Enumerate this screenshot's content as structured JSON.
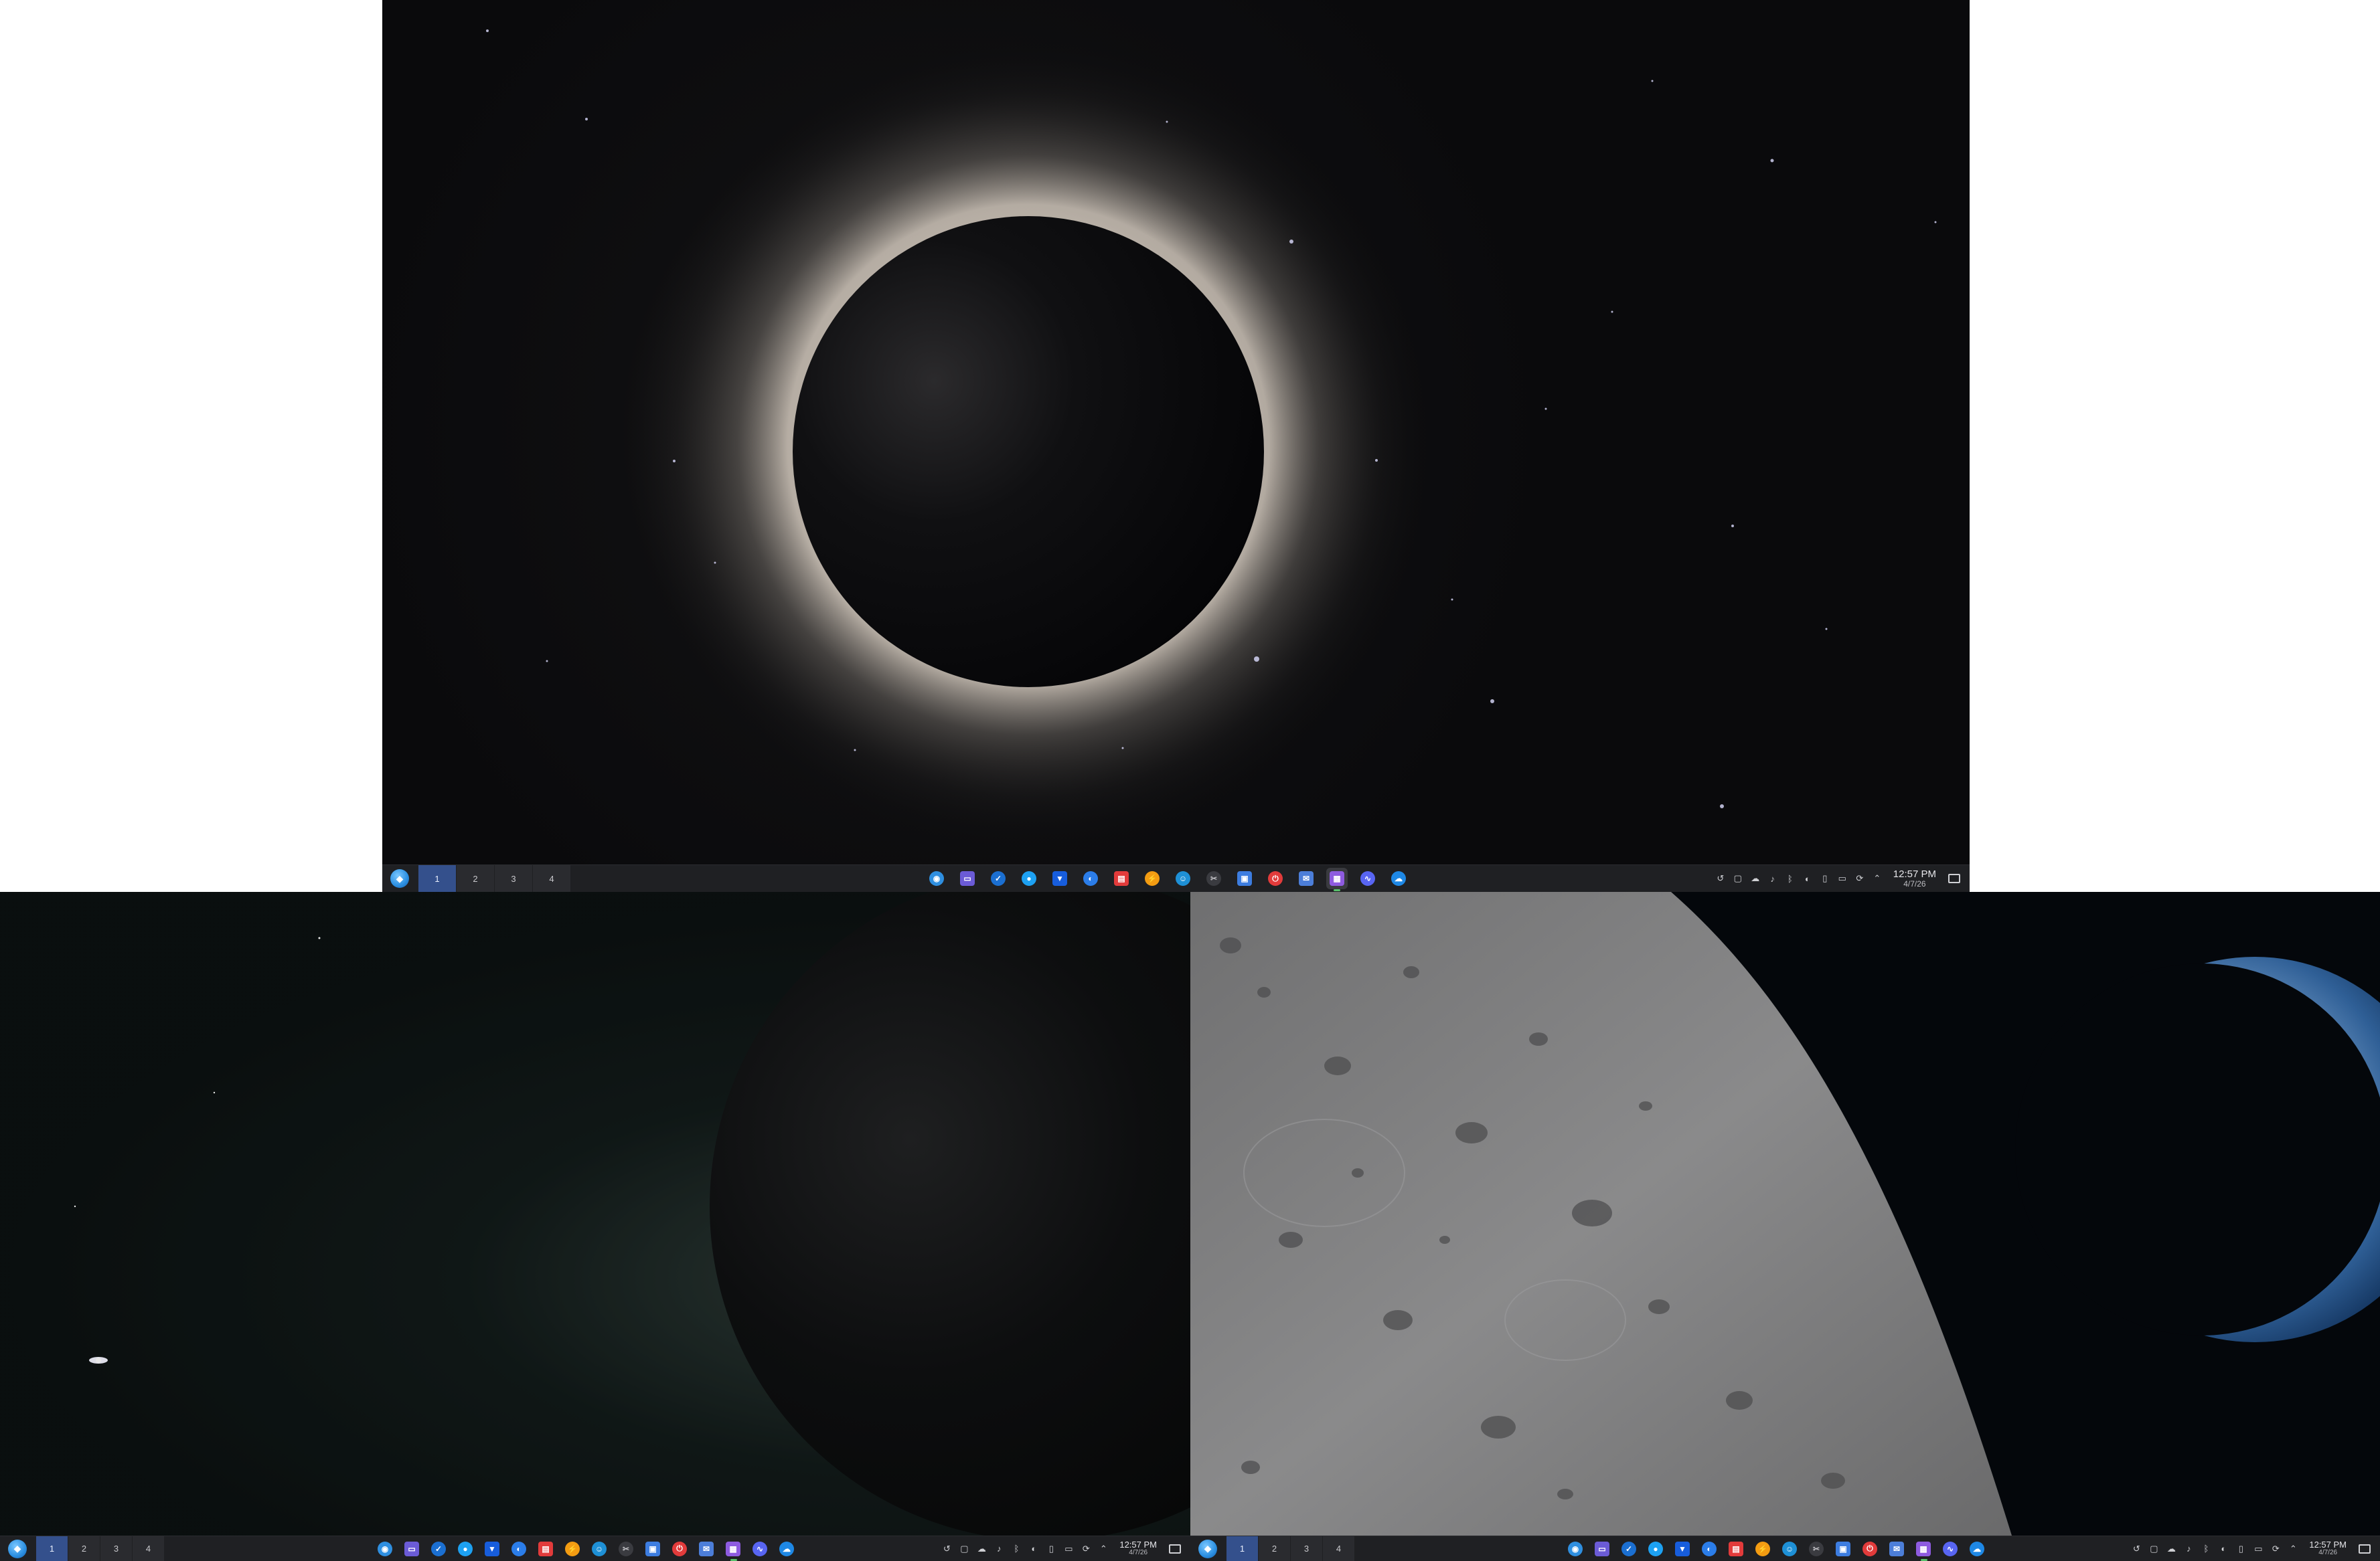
{
  "taskbar": {
    "virtual_desktops": [
      "1",
      "2",
      "3",
      "4"
    ],
    "active_desktop": "1",
    "clock": {
      "time": "12:57 PM",
      "date": "4/7/26"
    },
    "pinned_apps": [
      {
        "name": "browser-icon",
        "color": "#2f8fe0"
      },
      {
        "name": "files-icon",
        "color": "#6b5bd6"
      },
      {
        "name": "steam-icon",
        "color": "#1b6fd1"
      },
      {
        "name": "chat-icon",
        "color": "#1da1f2"
      },
      {
        "name": "bitwarden-icon",
        "color": "#175ddc"
      },
      {
        "name": "messenger-icon",
        "color": "#2b7de9"
      },
      {
        "name": "media-icon",
        "color": "#e23b3b"
      },
      {
        "name": "bolt-icon",
        "color": "#f39c12"
      },
      {
        "name": "accessibility-icon",
        "color": "#1e90d6"
      },
      {
        "name": "tool-icon",
        "color": "#8a8a8f"
      },
      {
        "name": "window-icon",
        "color": "#3d7de0"
      },
      {
        "name": "power-icon",
        "color": "#e23b3b"
      },
      {
        "name": "mail-icon",
        "color": "#4c7ed9"
      },
      {
        "name": "screenshot-icon",
        "color": "#8e5be0"
      },
      {
        "name": "monitor-icon",
        "color": "#5865f2"
      },
      {
        "name": "cloud-icon",
        "color": "#1e88e5"
      }
    ],
    "tray_icons": [
      "history-icon",
      "clipboard-icon",
      "cloud-sync-icon",
      "volume-muted-icon",
      "bluetooth-icon",
      "brightness-icon",
      "battery-icon",
      "display-icon",
      "update-icon",
      "chevron-up-icon"
    ]
  }
}
